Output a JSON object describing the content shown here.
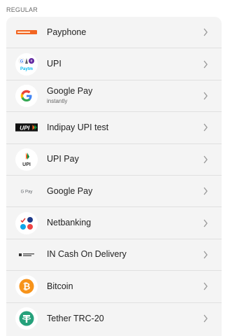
{
  "section": {
    "label": "REGULAR"
  },
  "methods": [
    {
      "name": "Payphone",
      "sub": "",
      "icon": "payphone-logo-icon"
    },
    {
      "name": "UPI",
      "sub": "",
      "icon": "upi-apps-icon",
      "icon_text": "Paytm"
    },
    {
      "name": "Google Pay",
      "sub": "instantly",
      "icon": "google-g-icon"
    },
    {
      "name": "Indipay UPI test",
      "sub": "",
      "icon": "upi-logo-icon",
      "icon_text": "UPI"
    },
    {
      "name": "UPI Pay",
      "sub": "",
      "icon": "upi-pay-icon",
      "icon_text": "UPI"
    },
    {
      "name": "Google Pay",
      "sub": "",
      "icon": "gpay-icon",
      "icon_text": "G Pay"
    },
    {
      "name": "Netbanking",
      "sub": "",
      "icon": "netbanking-icon"
    },
    {
      "name": "IN Cash On Delivery",
      "sub": "",
      "icon": "cod-icon"
    },
    {
      "name": "Bitcoin",
      "sub": "",
      "icon": "bitcoin-icon"
    },
    {
      "name": "Tether TRC-20",
      "sub": "",
      "icon": "tether-icon"
    }
  ],
  "colors": {
    "card_bg": "#f4f4f4",
    "bitcoin": "#f7931a",
    "tether": "#26a17b",
    "chevron": "#9a9a9a"
  }
}
